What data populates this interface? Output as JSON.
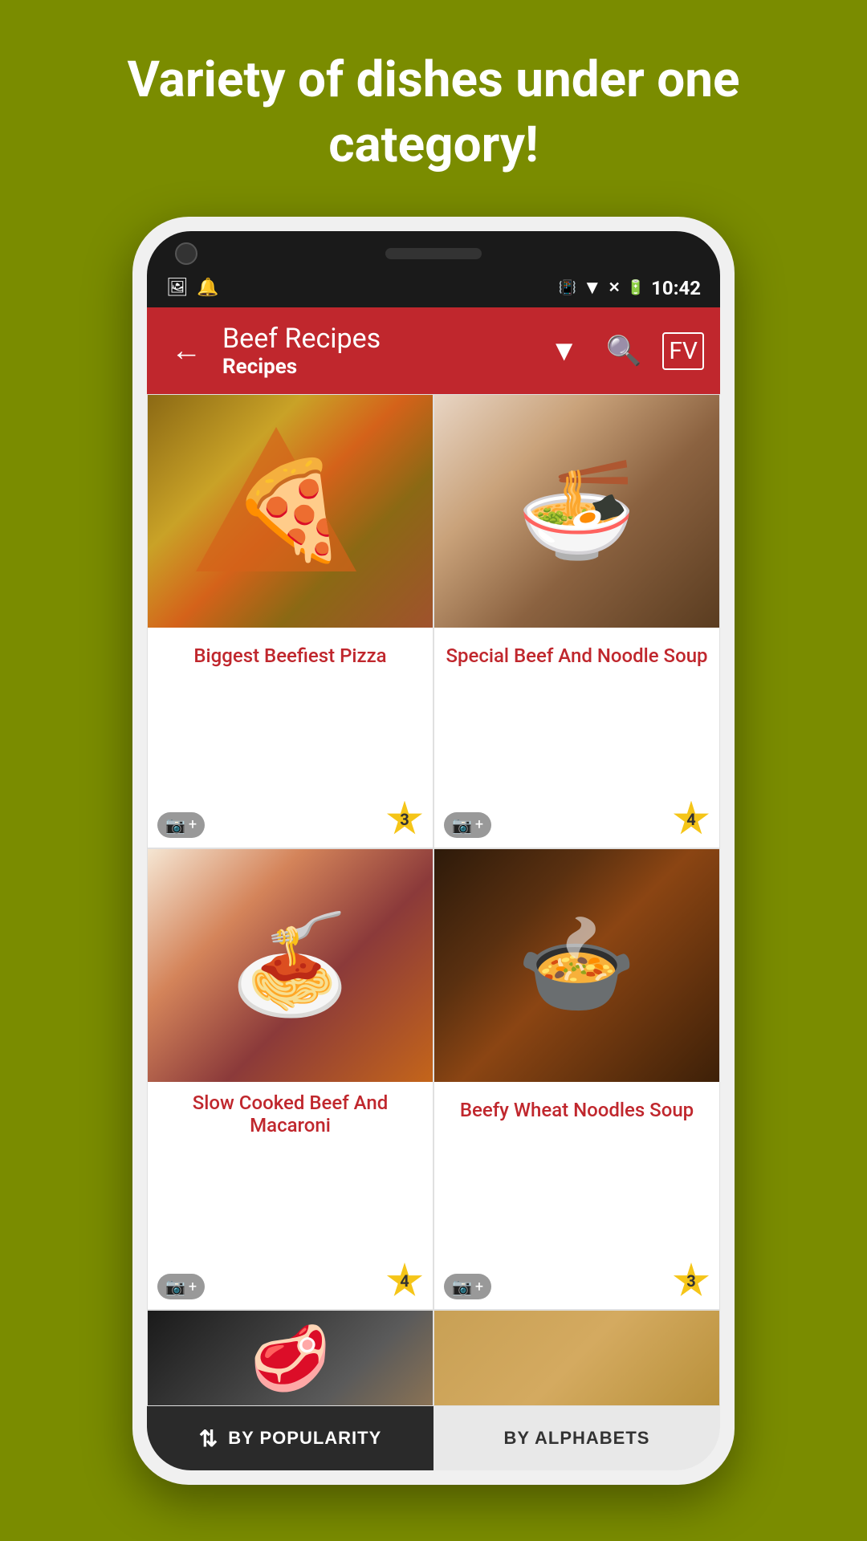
{
  "background": {
    "color": "#7a8c00",
    "tagline": "Variety of dishes under one category!"
  },
  "status_bar": {
    "time": "10:42",
    "icons": [
      "image",
      "notification",
      "vibrate",
      "wifi",
      "no-signal",
      "battery"
    ]
  },
  "app_bar": {
    "title": "Beef Recipes",
    "subtitle": "Recipes",
    "back_label": "←",
    "filter_icon": "filter",
    "search_icon": "search",
    "logo_icon": "logo"
  },
  "recipes": [
    {
      "id": 1,
      "name": "Biggest Beefiest Pizza",
      "rating": 3,
      "image_type": "pizza"
    },
    {
      "id": 2,
      "name": "Special Beef And Noodle Soup",
      "rating": 4,
      "image_type": "soup"
    },
    {
      "id": 3,
      "name": "Slow Cooked Beef And Macaroni",
      "rating": 4,
      "image_type": "pasta"
    },
    {
      "id": 4,
      "name": "Beefy Wheat Noodles Soup",
      "rating": 3,
      "image_type": "noodles"
    }
  ],
  "partial_recipes": [
    {
      "id": 5,
      "image_type": "partial1"
    },
    {
      "id": 6,
      "image_type": "partial2"
    }
  ],
  "bottom_bar": {
    "popularity_label": "BY POPULARITY",
    "alphabets_label": "BY ALPHABETS",
    "sort_icon": "⇅"
  }
}
